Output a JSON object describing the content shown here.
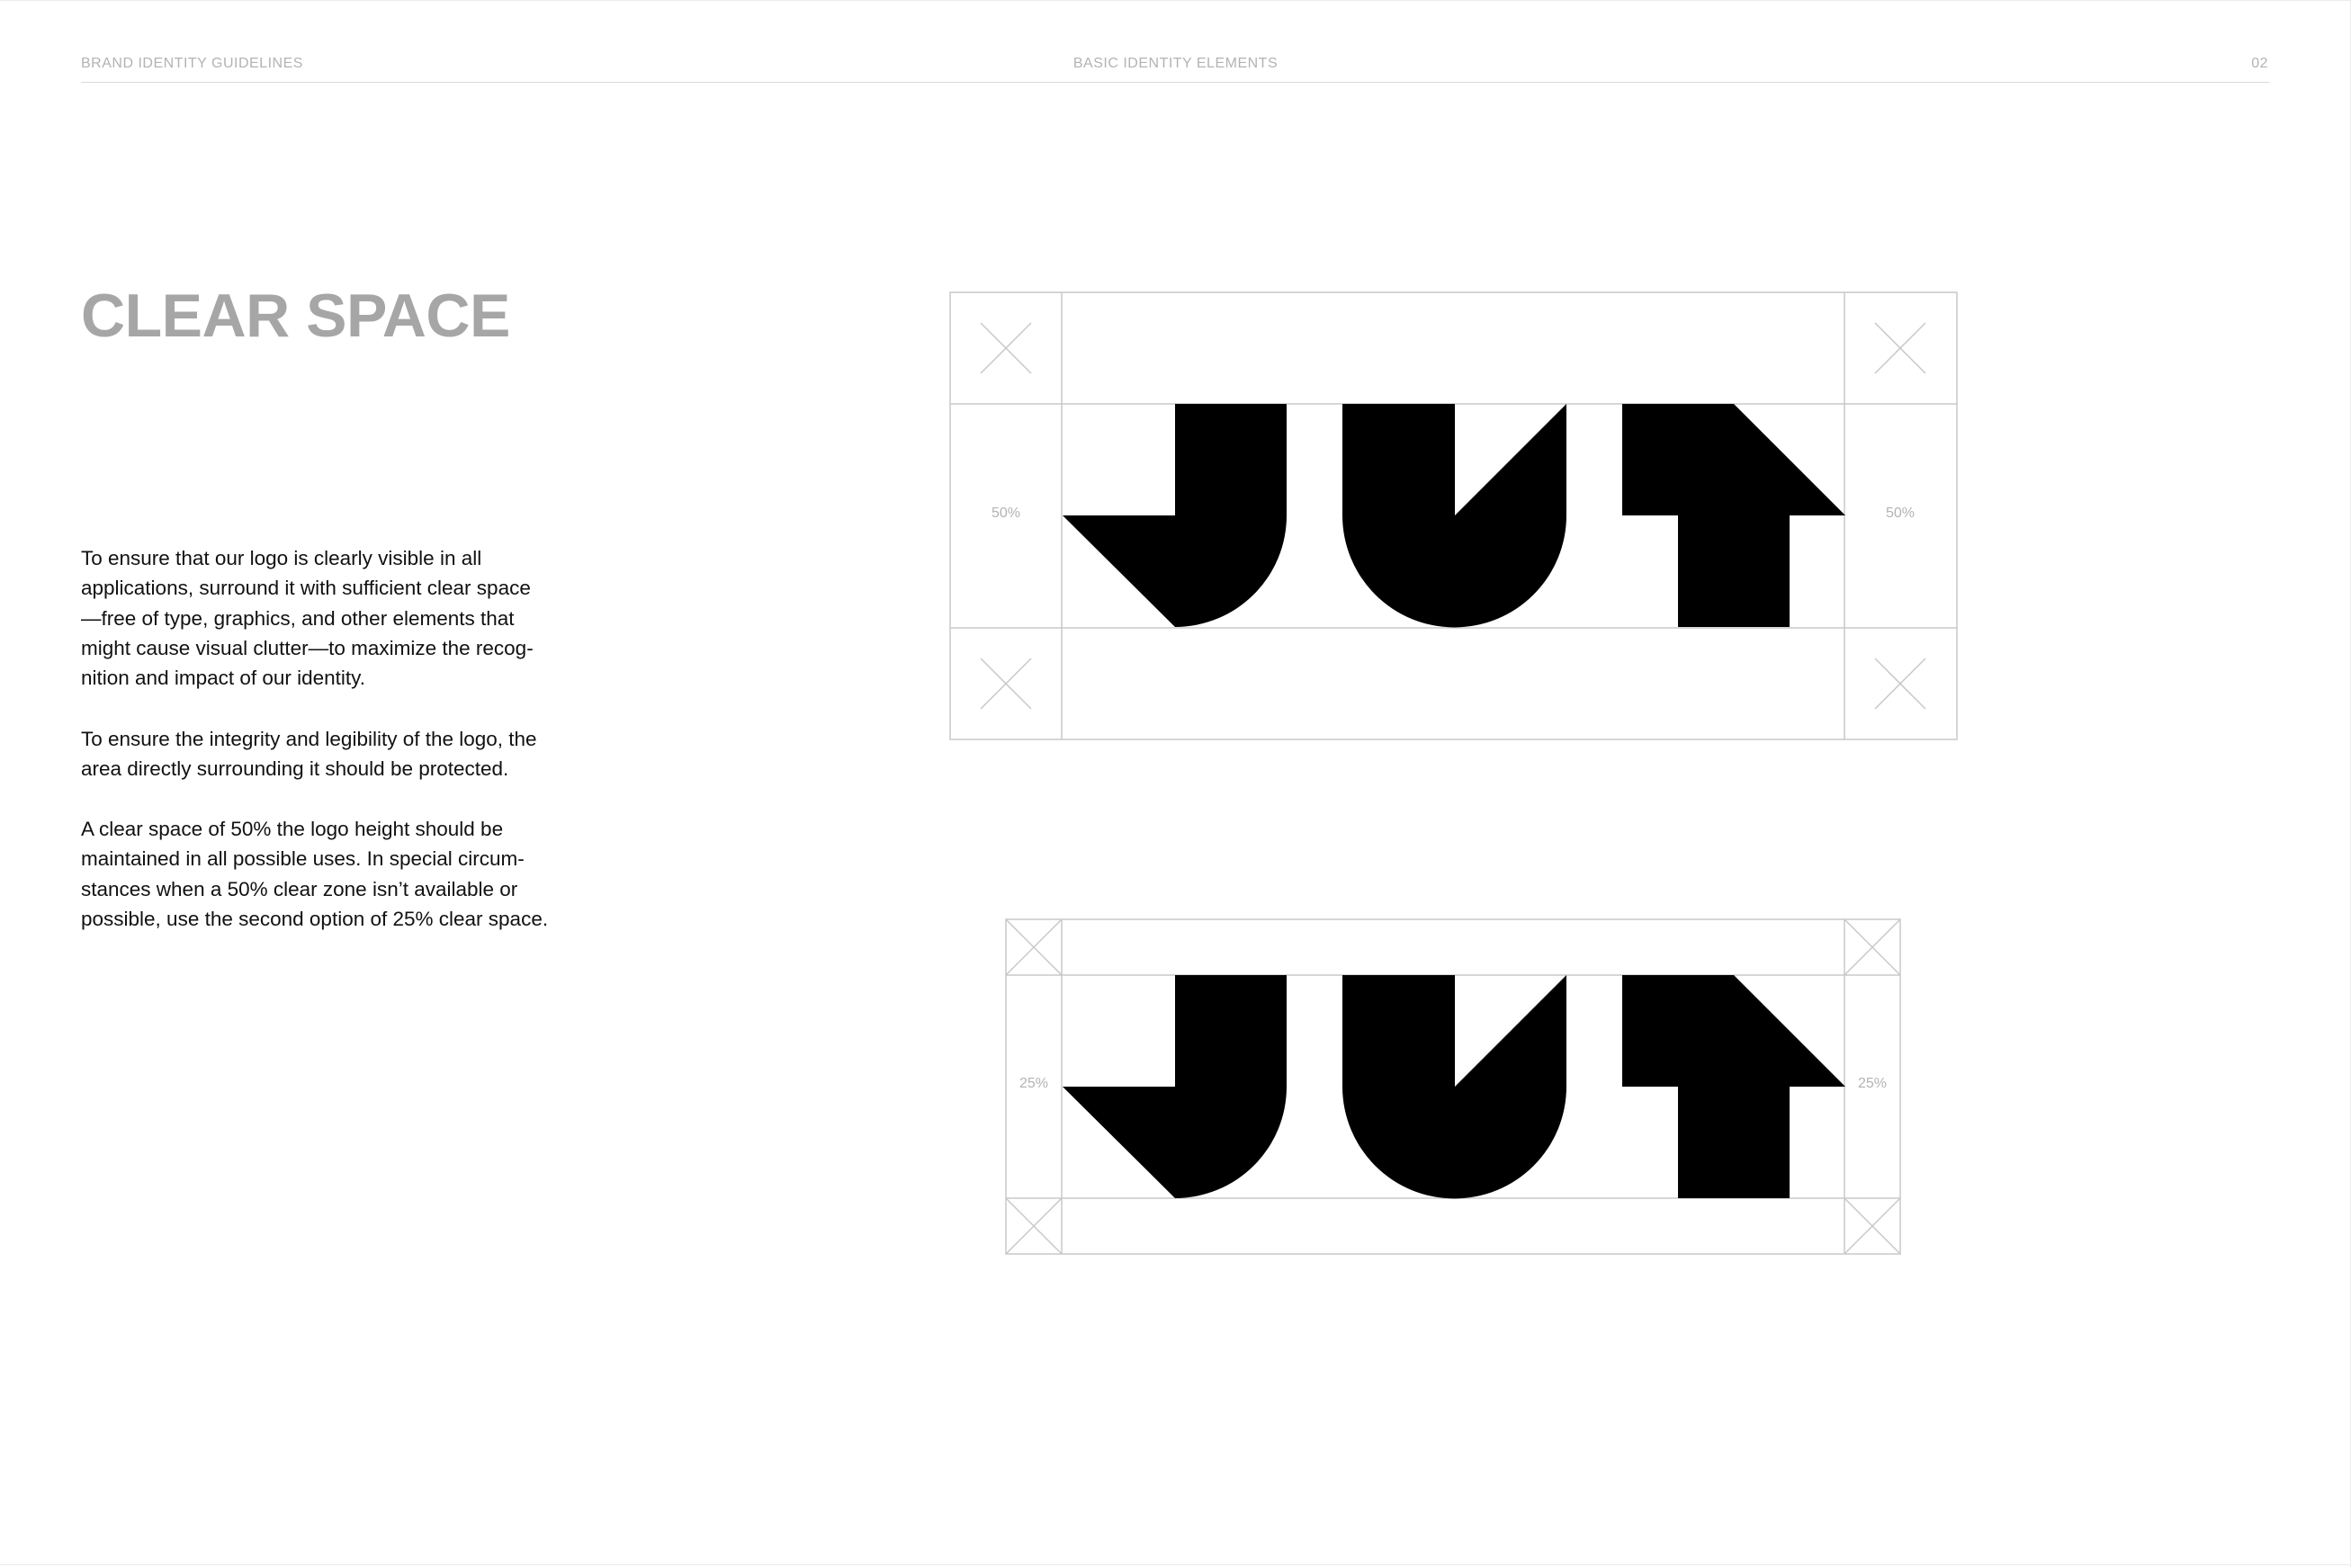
{
  "header": {
    "left": "BRAND IDENTITY GUIDELINES",
    "center": "BASIC IDENTITY ELEMENTS",
    "page_number": "02"
  },
  "section": {
    "title": "CLEAR SPACE"
  },
  "body": {
    "paragraph1": [
      "To ensure that our logo is clearly visible in all",
      "applications, surround it with sufficient clear space",
      "—free of type, graphics, and other elements that",
      "might cause visual clutter—to maximize the recog-",
      "nition and impact of our identity."
    ],
    "paragraph2": [
      "To ensure the integrity and legibility of the logo, the",
      "area directly surrounding it should be protected."
    ],
    "paragraph3": [
      "A clear space of 50% the logo height should be",
      "maintained in all possible uses. In special circum-",
      "stances when a 50% clear zone isn’t available or",
      "possible, use the second option of 25% clear space."
    ]
  },
  "diagrams": {
    "large": {
      "left_label": "50%",
      "right_label": "50%"
    },
    "small": {
      "left_label": "25%",
      "right_label": "25%"
    }
  },
  "colors": {
    "logo": "#000000",
    "guide_lines": "#c8c8c8",
    "title": "#a6a6a6",
    "header_text": "#b3b3b3"
  }
}
